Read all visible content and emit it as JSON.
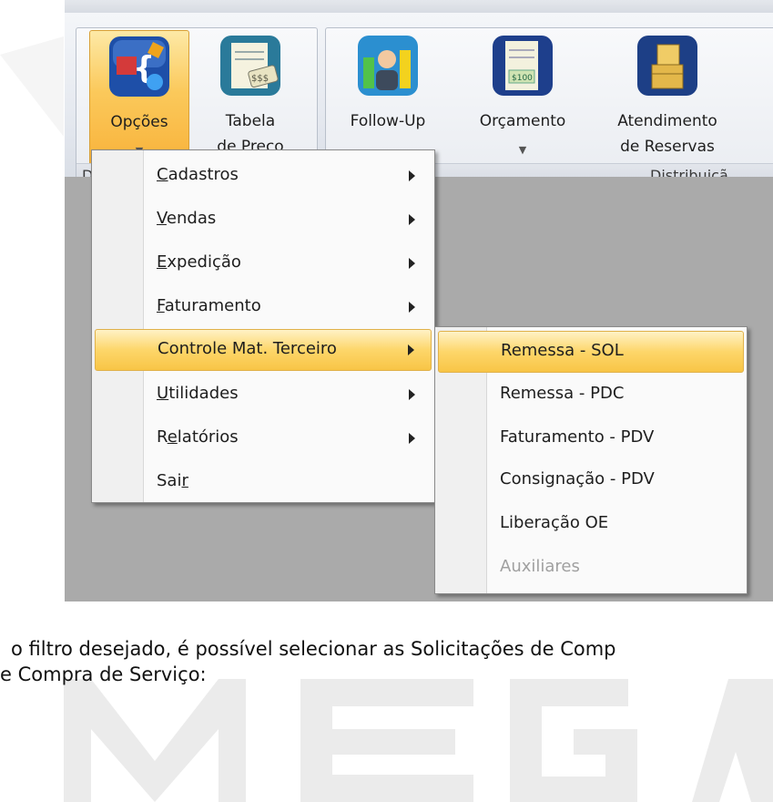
{
  "ribbon": {
    "buttons": [
      {
        "line1": "Opções",
        "line2": "",
        "icon": "options-puzzle-icon",
        "dropdown": true
      },
      {
        "line1": "Tabela",
        "line2": "de Preço",
        "icon": "price-table-icon",
        "dropdown": false
      },
      {
        "line1": "Follow-Up",
        "line2": "",
        "icon": "follow-up-chart-icon",
        "dropdown": false
      },
      {
        "line1": "Orçamento",
        "line2": "",
        "icon": "budget-document-icon",
        "dropdown": true
      },
      {
        "line1": "Atendimento",
        "line2": "de Reservas",
        "icon": "reservations-boxes-icon",
        "dropdown": false
      }
    ],
    "groups": [
      {
        "label": "D"
      },
      {
        "label": "Distribuiçã"
      }
    ]
  },
  "menu": {
    "items": [
      {
        "label_underline": "C",
        "label_rest": "adastros",
        "submenu": true
      },
      {
        "label_underline": "V",
        "label_rest": "endas",
        "submenu": true
      },
      {
        "label_underline": "E",
        "label_rest": "xpedição",
        "submenu": true
      },
      {
        "label_underline": "F",
        "label_rest": "aturamento",
        "submenu": true
      },
      {
        "label_full": "Controle Mat. Terceiro",
        "submenu": true,
        "highlighted": true
      },
      {
        "label_underline": "U",
        "label_rest": "tilidades",
        "submenu": true
      },
      {
        "label_pre": "R",
        "label_underline": "e",
        "label_rest": "latórios",
        "submenu": true
      },
      {
        "label_pre": "Sai",
        "label_underline": "r",
        "label_rest": "",
        "submenu": false
      }
    ]
  },
  "submenu": {
    "items": [
      {
        "label": "Remessa - SOL",
        "highlighted": true
      },
      {
        "label": "Remessa - PDC"
      },
      {
        "label": "Faturamento - PDV"
      },
      {
        "label": "Consignação - PDV"
      },
      {
        "label": "Liberação OE"
      },
      {
        "label": "Auxiliares",
        "disabled": true
      }
    ]
  },
  "caption": {
    "line1": "o filtro desejado, é possível selecionar as Solicitações de Comp",
    "line2": "e Compra de Serviço:"
  },
  "watermark": {
    "text": "MEGA",
    "color": "#e8e8e8"
  },
  "colors": {
    "highlight": "#fbc95b",
    "workspace": "#aaaaaa"
  }
}
